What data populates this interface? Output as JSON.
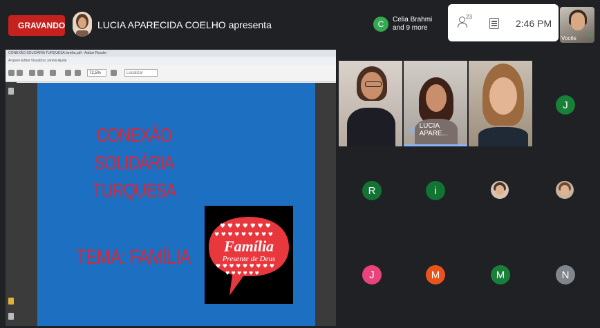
{
  "topbar": {
    "recording_label": "GRAVANDO",
    "presenter_label": "LUCIA APARECIDA COELHO apresenta",
    "chat_chip": {
      "initial": "C",
      "line1": "Celia Brahmi",
      "line2": "and 9 more"
    },
    "people_count": "23",
    "time": "2:46 PM",
    "self_label": "Vocês"
  },
  "pdf": {
    "window_title": "CONEXÃO SOLIDÁRIA TURQUESA familia.pdf - Adobe Reader",
    "menu": "Arquivo  Editar  Visualizar  Janela  Ajuda",
    "zoom": "72,5%",
    "find_placeholder": "Localizar"
  },
  "slide": {
    "title_line1": "CONEXÃO SOLIDÁRIA",
    "title_line2": "TURQUESA",
    "theme": "TEMA: FAMÍLIA",
    "logo_line1": "Família",
    "logo_line2": "Presente de Deus"
  },
  "participants": {
    "video_tile_name": "LUCIA APARE...",
    "initials": [
      {
        "letter": "J",
        "color": "#188038"
      },
      {
        "letter": "R",
        "color": "#137333"
      },
      {
        "letter": "i",
        "color": "#137333"
      },
      {
        "letter": "J",
        "color": "#e8437b"
      },
      {
        "letter": "M",
        "color": "#e8541c"
      },
      {
        "letter": "M",
        "color": "#188038"
      },
      {
        "letter": "N",
        "color": "#80868b"
      }
    ]
  }
}
